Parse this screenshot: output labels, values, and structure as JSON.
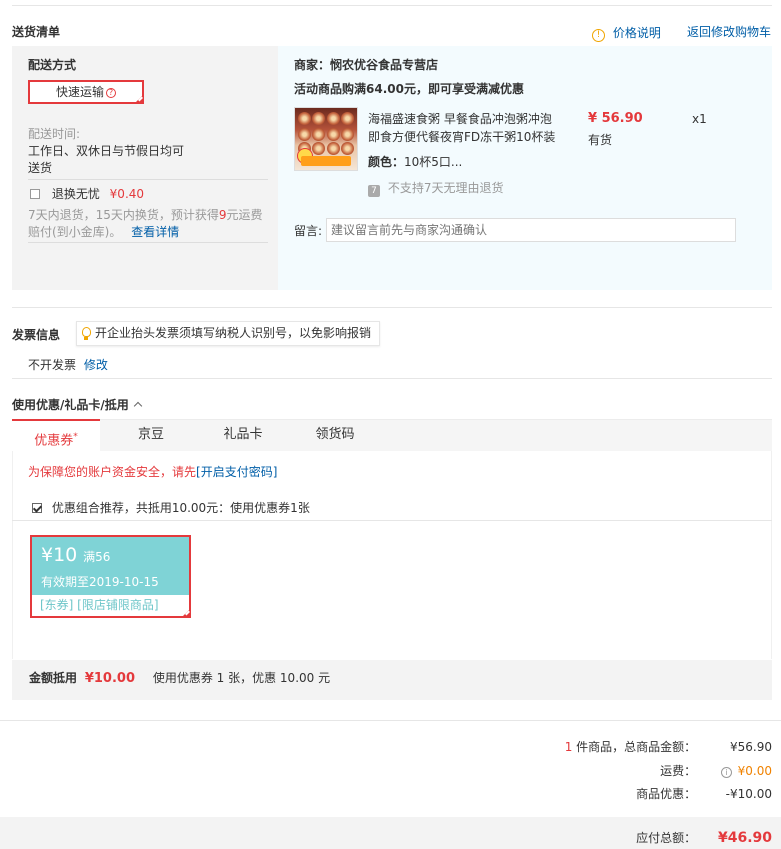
{
  "delivery": {
    "section_title": "送货清单",
    "price_explain_label": "价格说明",
    "back_to_cart_label": "返回修改购物车",
    "ship_method_label": "配送方式",
    "ship_method_value": "快速运输",
    "ship_time_label": "配送时间:",
    "ship_time_value_line1": "工作日、双休日与节假日均可",
    "ship_time_value_line2": "送货",
    "swap_label": "退换无忧",
    "swap_price": "¥0.40",
    "swap_desc_line1_pre": "7天内退货，15天内换货，预计获得",
    "swap_desc_highlight": "9",
    "swap_desc_line1_post": "元运费",
    "swap_desc_line2": "赔付(到小金库)。",
    "swap_detail_link": "查看详情"
  },
  "shop": {
    "name_label": "商家：悯农优谷食品专营店",
    "promo": "活动商品购满64.00元，即可享受满减优惠",
    "product_title_line1": "海福盛速食粥 早餐食品冲泡粥冲泡",
    "product_title_line2": "即食方便代餐夜宵FD冻干粥10杯装",
    "price": "¥ 56.90",
    "stock": "有货",
    "qty": "x1",
    "color_label": "颜色：",
    "color_value": "10杯5口...",
    "no_return_text": "不支持7天无理由退货",
    "memo_label": "留言:",
    "memo_placeholder": "建议留言前先与商家沟通确认"
  },
  "invoice": {
    "title": "发票信息",
    "tip": "开企业抬头发票须填写纳税人识别号，以免影响报销",
    "value": "不开发票",
    "edit_link": "修改"
  },
  "coupons": {
    "title": "使用优惠/礼品卡/抵用",
    "tabs": [
      "优惠券",
      "京豆",
      "礼品卡",
      "领货码"
    ],
    "tab_star": "*",
    "security_tip": "为保障您的账户资金安全，请先",
    "security_link": "[开启支付密码]",
    "combo_text": "优惠组合推荐，共抵用10.00元：使用优惠券1张",
    "card_amount": "¥10",
    "card_condition": "满56",
    "card_valid": "有效期至2019-10-15",
    "card_tags": "[东券]  [限店铺限商品]",
    "deduct_label": "金额抵用",
    "deduct_amount": "¥10.00",
    "deduct_desc": "使用优惠券 1 张，优惠 10.00 元"
  },
  "summary": {
    "count": "1",
    "count_label": " 件商品，总商品金额：",
    "goods_total": "¥56.90",
    "freight_label": "运费：",
    "freight_value": "¥0.00",
    "discount_label": "商品优惠：",
    "discount_value": "-¥10.00",
    "payable_label": "应付总额：",
    "payable_value": "¥46.90"
  },
  "colors": {
    "accent_red": "#e4393c",
    "link_blue": "#005ea7",
    "coupon_teal": "#7fd3d6"
  }
}
